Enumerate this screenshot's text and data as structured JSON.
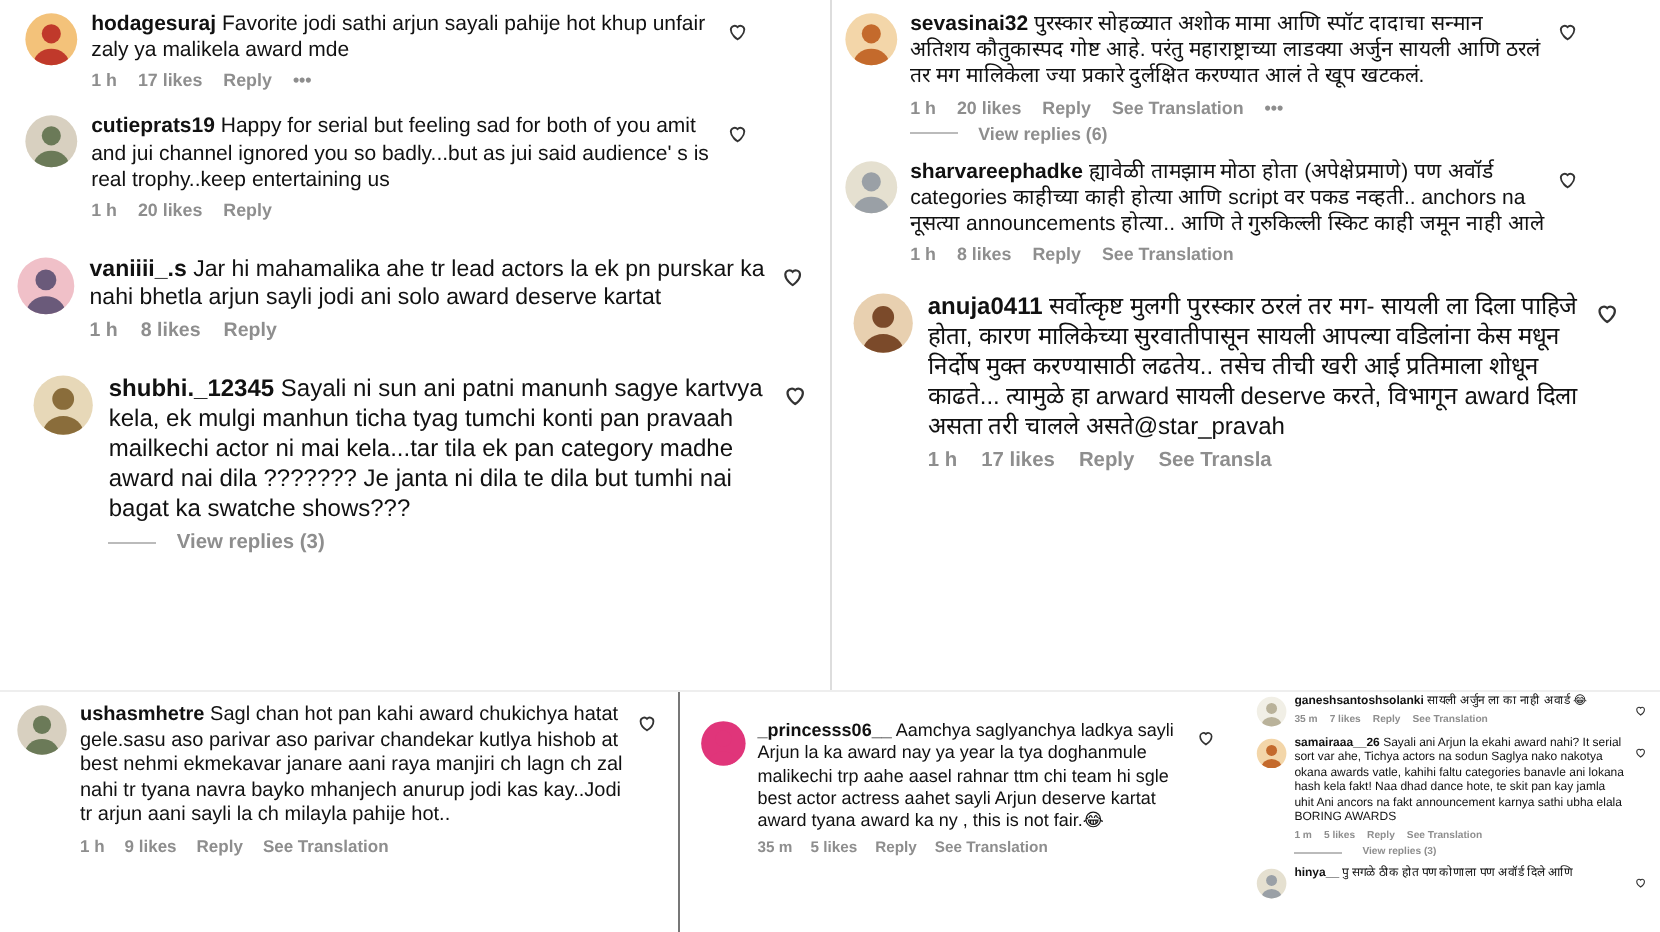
{
  "panels": [
    {
      "comments": [
        {
          "text": "**hodagesuraj** Favorite jodi sathi arjun sayali pahije hot khup unfair zaly ya malikela award mde",
          "time": "1 h",
          "likes": "17 likes",
          "reply": "Reply",
          "more": "•••"
        },
        {
          "text": "**cutieprats19** Happy for serial but feeling sad for both of you amit and jui channel ignored you so badly...but as jui said audience' s is real trophy..keep entertaining us",
          "time": "1 h",
          "likes": "20 likes",
          "reply": "Reply"
        }
      ]
    },
    {
      "comments": [
        {
          "text": "**vaniiii_.s** Jar hi mahamalika ahe tr lead actors la ek pn purskar ka nahi bhetla arjun sayli jodi ani solo award deserve kartat",
          "time": "1 h",
          "likes": "8 likes",
          "reply": "Reply"
        }
      ]
    },
    {
      "comments": [
        {
          "text": "**shubhi._12345** Sayali ni sun ani patni manunh sagye kartvya kela, ek mulgi manhun ticha tyag tumchi konti pan pravaah mailkechi actor ni mai kela...tar tila ek pan category madhe award nai dila ??????? Je janta ni dila te dila but tumhi nai bagat ka swatche shows???",
          "view_replies": "View replies (3)"
        }
      ]
    },
    {
      "comments": [
        {
          "text": "**sevasinai32** पुरस्कार सोहळ्यात अशोक मामा आणि स्पॉट दादाचा सन्मान अतिशय कौतुकास्पद गोष्ट आहे. परंतु महाराष्ट्राच्या लाडक्या अर्जुन सायली आणि ठरलं तर मग मालिकेला ज्या प्रकारे दुर्लक्षित करण्यात आलं ते खूप खटकलं.",
          "time": "1 h",
          "likes": "20 likes",
          "reply": "Reply",
          "translate": "See Translation",
          "more": "•••",
          "view_replies": "View replies (6)"
        },
        {
          "text": "**sharvareephadke** ह्यावेळी तामझाम मोठा होता (अपेक्षेप्रमाणे) पण अवॉर्ड categories काहीच्या काही होत्या आणि script वर पकड नव्हती.. anchors na नूसत्या announcements होत्या.. आणि ते गुरुकिल्ली स्किट काही जमून नाही आले",
          "time": "1 h",
          "likes": "8 likes",
          "reply": "Reply",
          "translate": "See Translation"
        }
      ]
    },
    {
      "comments": [
        {
          "text": "**anuja0411** सर्वोत्कृष्ट मुलगी पुरस्कार ठरलं तर मग- सायली ला दिला पाहिजे होता, कारण मालिकेच्या सुरवातीपासून सायली आपल्या वडिलांना केस मधून निर्दोष मुक्त करण्यासाठी लढतेय.. तसेच तीची खरी आई प्रतिमाला शोधून काढते... त्यामुळे हा arward सायली deserve करते, विभागून award दिला असता तरी चालले असते@star_pravah",
          "time": "1 h",
          "likes": "17 likes",
          "reply": "Reply",
          "translate": "See Transla"
        }
      ]
    },
    {
      "comments": [
        {
          "text": "**ushasmhetre** Sagl chan hot pan kahi award chukichya hatat gele.sasu aso parivar aso parivar chandekar kutlya hishob at best nehmi ekmekavar janare aani raya manjiri ch lagn ch zal nahi tr tyana navra bayko mhanjech anurup jodi kas kay..Jodi tr arjun aani sayli la ch milayla pahije hot..",
          "time": "1 h",
          "likes": "9 likes",
          "reply": "Reply",
          "translate": "See Translation"
        }
      ]
    },
    {
      "comments": [
        {
          "text": "**_princesss06__** Aamchya saglyanchya ladkya sayli Arjun la ka award nay ya year la tya doghanmule malikechi trp aahe aasel rahnar ttm chi team hi sgle best actor actress aahet sayli Arjun deserve kartat award tyana award ka ny , this is not fair.😂",
          "time": "35 m",
          "likes": "5 likes",
          "reply": "Reply",
          "translate": "See Translation"
        }
      ]
    },
    {
      "comments": [
        {
          "text": "**ganeshsantoshsolanki** सायली अर्जुन ला का नाही अवार्ड 😂",
          "time": "35 m",
          "likes": "7 likes",
          "reply": "Reply",
          "translate": "See Translation"
        },
        {
          "text": "**samairaaa__26** Sayali ani Arjun la ekahi award nahi? It serial sort var ahe, Tichya actors na sodun Saglya nako nakotya okana awards vatle, kahihi faltu categories banavle ani lokana hash kela fakt! Naa dhad dance hote, te skit pan kay jamla uhit Ani ancors na fakt announcement karnya sathi ubha elala BORING AWARDS",
          "time": "1 m",
          "likes": "5 likes",
          "reply": "Reply",
          "translate": "See Translation",
          "view_replies": "View replies (3)"
        },
        {
          "text": "**hinya__** पु सगळे ठीक होत पण कोणाला पण अवॉर्ड दिले आणि"
        }
      ]
    }
  ]
}
